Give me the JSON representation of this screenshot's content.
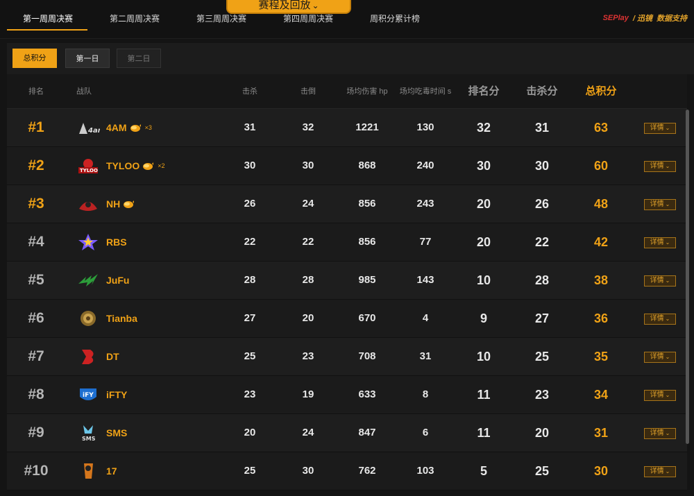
{
  "nav": {
    "tabs": [
      {
        "label": "第一周周决赛"
      },
      {
        "label": "第二周周决赛"
      },
      {
        "label": "第三周周决赛"
      },
      {
        "label": "第四周周决赛"
      },
      {
        "label": "周积分累计榜"
      }
    ],
    "schedule_label": "赛程及回放",
    "brand": {
      "seplay": "SEPlay",
      "partner": "/ 迅镜",
      "support": "数据支持"
    }
  },
  "filters": {
    "total": "总积分",
    "day1": "第一日",
    "day2": "第二日"
  },
  "columns": {
    "rank": "排名",
    "team": "战队",
    "kills": "击杀",
    "knocks": "击倒",
    "avg_damage": "场均伤害 hp",
    "avg_poison_time": "场均吃毒时间 s",
    "placement_pts": "排名分",
    "kill_pts": "击杀分",
    "total_pts": "总积分"
  },
  "detail_label": "详情",
  "colors": {
    "accent": "#f0a216",
    "bg": "#141414"
  },
  "rows": [
    {
      "rank": "#1",
      "team": "4AM",
      "chickens": "×3",
      "kills": "31",
      "knocks": "32",
      "dmg": "1221",
      "poison": "130",
      "place": "32",
      "killpts": "31",
      "total": "63"
    },
    {
      "rank": "#2",
      "team": "TYLOO",
      "chickens": "×2",
      "kills": "30",
      "knocks": "30",
      "dmg": "868",
      "poison": "240",
      "place": "30",
      "killpts": "30",
      "total": "60"
    },
    {
      "rank": "#3",
      "team": "NH",
      "chickens": "",
      "kills": "26",
      "knocks": "24",
      "dmg": "856",
      "poison": "243",
      "place": "20",
      "killpts": "26",
      "total": "48"
    },
    {
      "rank": "#4",
      "team": "RBS",
      "kills": "22",
      "knocks": "22",
      "dmg": "856",
      "poison": "77",
      "place": "20",
      "killpts": "22",
      "total": "42"
    },
    {
      "rank": "#5",
      "team": "JuFu",
      "kills": "28",
      "knocks": "28",
      "dmg": "985",
      "poison": "143",
      "place": "10",
      "killpts": "28",
      "total": "38"
    },
    {
      "rank": "#6",
      "team": "Tianba",
      "kills": "27",
      "knocks": "20",
      "dmg": "670",
      "poison": "4",
      "place": "9",
      "killpts": "27",
      "total": "36"
    },
    {
      "rank": "#7",
      "team": "DT",
      "kills": "25",
      "knocks": "23",
      "dmg": "708",
      "poison": "31",
      "place": "10",
      "killpts": "25",
      "total": "35"
    },
    {
      "rank": "#8",
      "team": "iFTY",
      "kills": "23",
      "knocks": "19",
      "dmg": "633",
      "poison": "8",
      "place": "11",
      "killpts": "23",
      "total": "34"
    },
    {
      "rank": "#9",
      "team": "SMS",
      "kills": "20",
      "knocks": "24",
      "dmg": "847",
      "poison": "6",
      "place": "11",
      "killpts": "20",
      "total": "31"
    },
    {
      "rank": "#10",
      "team": "17",
      "kills": "25",
      "knocks": "30",
      "dmg": "762",
      "poison": "103",
      "place": "5",
      "killpts": "25",
      "total": "30"
    }
  ]
}
